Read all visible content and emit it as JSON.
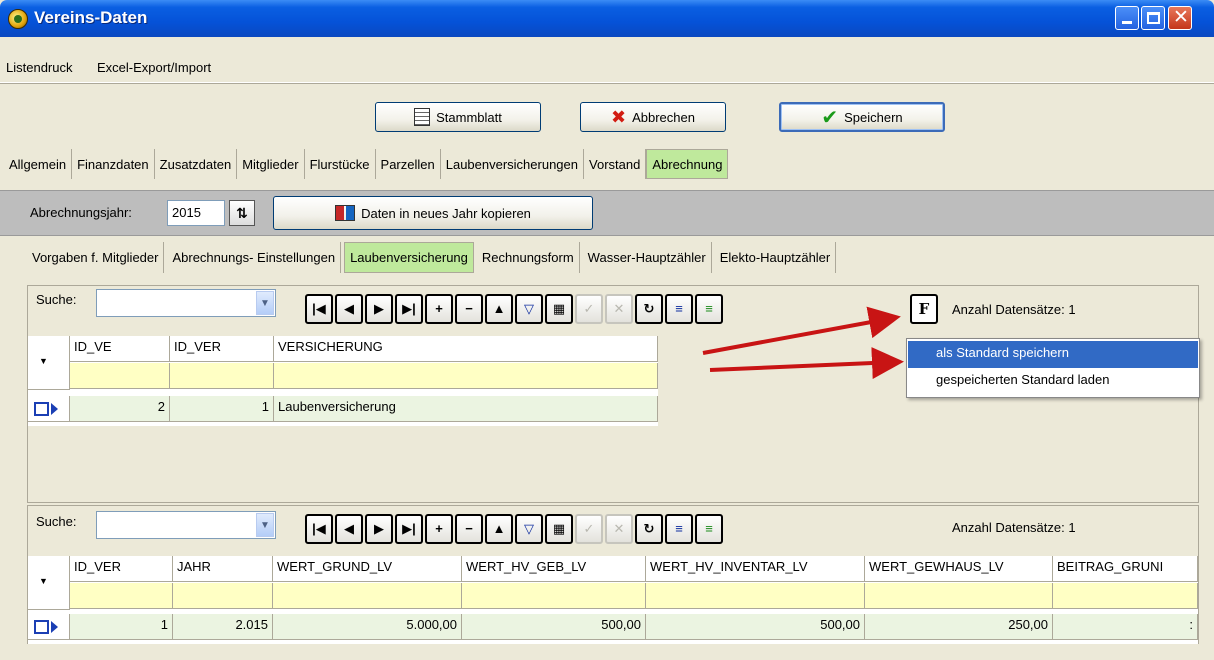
{
  "window": {
    "title": "Vereins-Daten"
  },
  "menu": [
    "Listendruck",
    "Excel-Export/Import"
  ],
  "toolbar": {
    "stammblatt": "Stammblatt",
    "abbrechen": "Abbrechen",
    "speichern": "Speichern"
  },
  "tabs": [
    "Allgemein",
    "Finanzdaten",
    "Zusatzdaten",
    "Mitglieder",
    "Flurstücke",
    "Parzellen",
    "Laubenversicherungen",
    "Vorstand",
    "Abrechnung"
  ],
  "active_tab": "Abrechnung",
  "abrechnung": {
    "jahr_label": "Abrechnungsjahr:",
    "jahr_value": "2015",
    "kopie_button": "Daten in neues Jahr kopieren"
  },
  "subtabs": [
    "Vorgaben f. Mitglieder",
    "Abrechnungs- Einstellungen",
    "Laubenversicherung",
    "Rechnungsform",
    "Wasser-Hauptzähler",
    "Elekto-Hauptzähler"
  ],
  "active_subtab": "Laubenversicherung",
  "panel1": {
    "search_label": "Suche:",
    "count_label": "Anzahl Datensätze:",
    "count_value": "1",
    "columns": [
      "ID_VE",
      "ID_VER",
      "VERSICHERUNG"
    ],
    "rows": [
      [
        "2",
        "1",
        "Laubenversicherung"
      ]
    ]
  },
  "context_menu": [
    "als Standard speichern",
    "gespeicherten Standard laden"
  ],
  "panel2": {
    "search_label": "Suche:",
    "count_label": "Anzahl Datensätze:",
    "count_value": "1",
    "columns": [
      "ID_VER",
      "JAHR",
      "WERT_GRUND_LV",
      "WERT_HV_GEB_LV",
      "WERT_HV_INVENTAR_LV",
      "WERT_GEWHAUS_LV",
      "BEITRAG_GRUNI"
    ],
    "rows": [
      [
        "1",
        "2.015",
        "5.000,00",
        "500,00",
        "500,00",
        "250,00",
        ":"
      ]
    ]
  },
  "colors": {
    "active_tab": "#bfe99c",
    "filter_row": "#ffffc4",
    "highlight": "#316ac5",
    "arrow": "#c81414"
  }
}
